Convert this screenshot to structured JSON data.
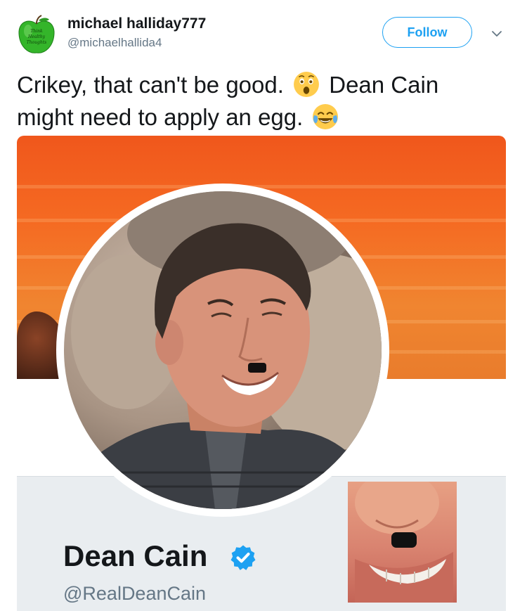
{
  "tweet": {
    "author": {
      "name": "michael halliday777",
      "handle": "@michaelhallida4",
      "avatar_icon": "green-apple-icon",
      "avatar_text": "Think Healthy Thoughts"
    },
    "follow_label": "Follow",
    "caret_icon": "chevron-down-icon",
    "text": {
      "part1": "Crikey, that can't be good.",
      "emoji1": "astonished-face-emoji",
      "part2": "Dean Cain might need to apply an egg.",
      "emoji2": "face-with-tears-of-joy-emoji"
    }
  },
  "media": {
    "profile_name": "Dean Cain",
    "profile_handle": "@RealDeanCain",
    "verified_icon": "verified-badge-icon"
  },
  "colors": {
    "accent": "#1da1f2",
    "banner": "#f26a22",
    "panel": "#e9edf0",
    "apple_green": "#3bbf2a"
  }
}
